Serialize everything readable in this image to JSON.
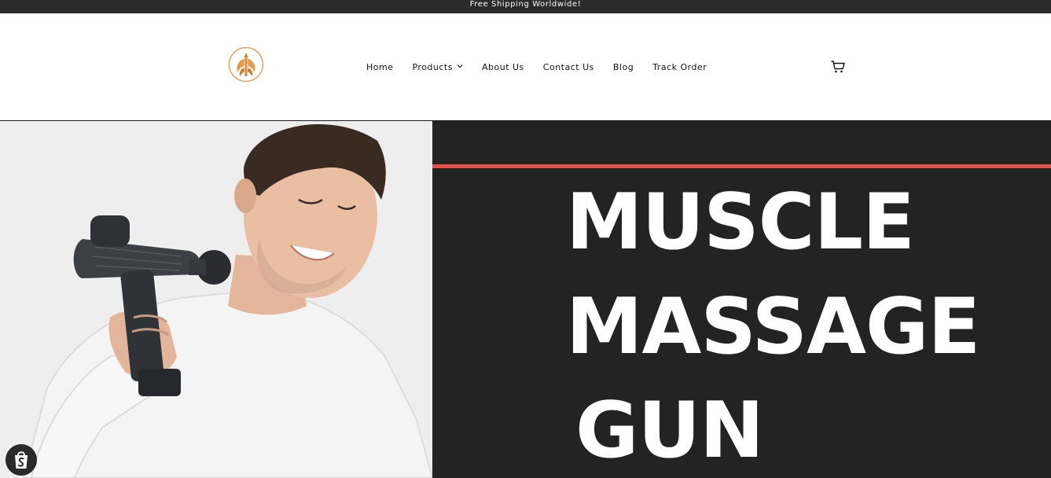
{
  "announcement": {
    "text": "Free Shipping Worldwide!"
  },
  "header": {
    "logo_icon": "phoenix-logo-icon",
    "nav": [
      {
        "label": "Home"
      },
      {
        "label": "Products",
        "has_dropdown": true
      },
      {
        "label": "About Us"
      },
      {
        "label": "Contact Us"
      },
      {
        "label": "Blog"
      },
      {
        "label": "Track Order"
      }
    ],
    "cart_icon": "cart-icon"
  },
  "hero": {
    "lines": [
      "MUSCLE",
      "MASSAGE",
      "GUN"
    ],
    "image": "man-using-massage-gun-photo",
    "accent_color": "#e5504a",
    "panel_color": "#232323"
  },
  "shopify_badge_icon": "shopify-bag-icon"
}
